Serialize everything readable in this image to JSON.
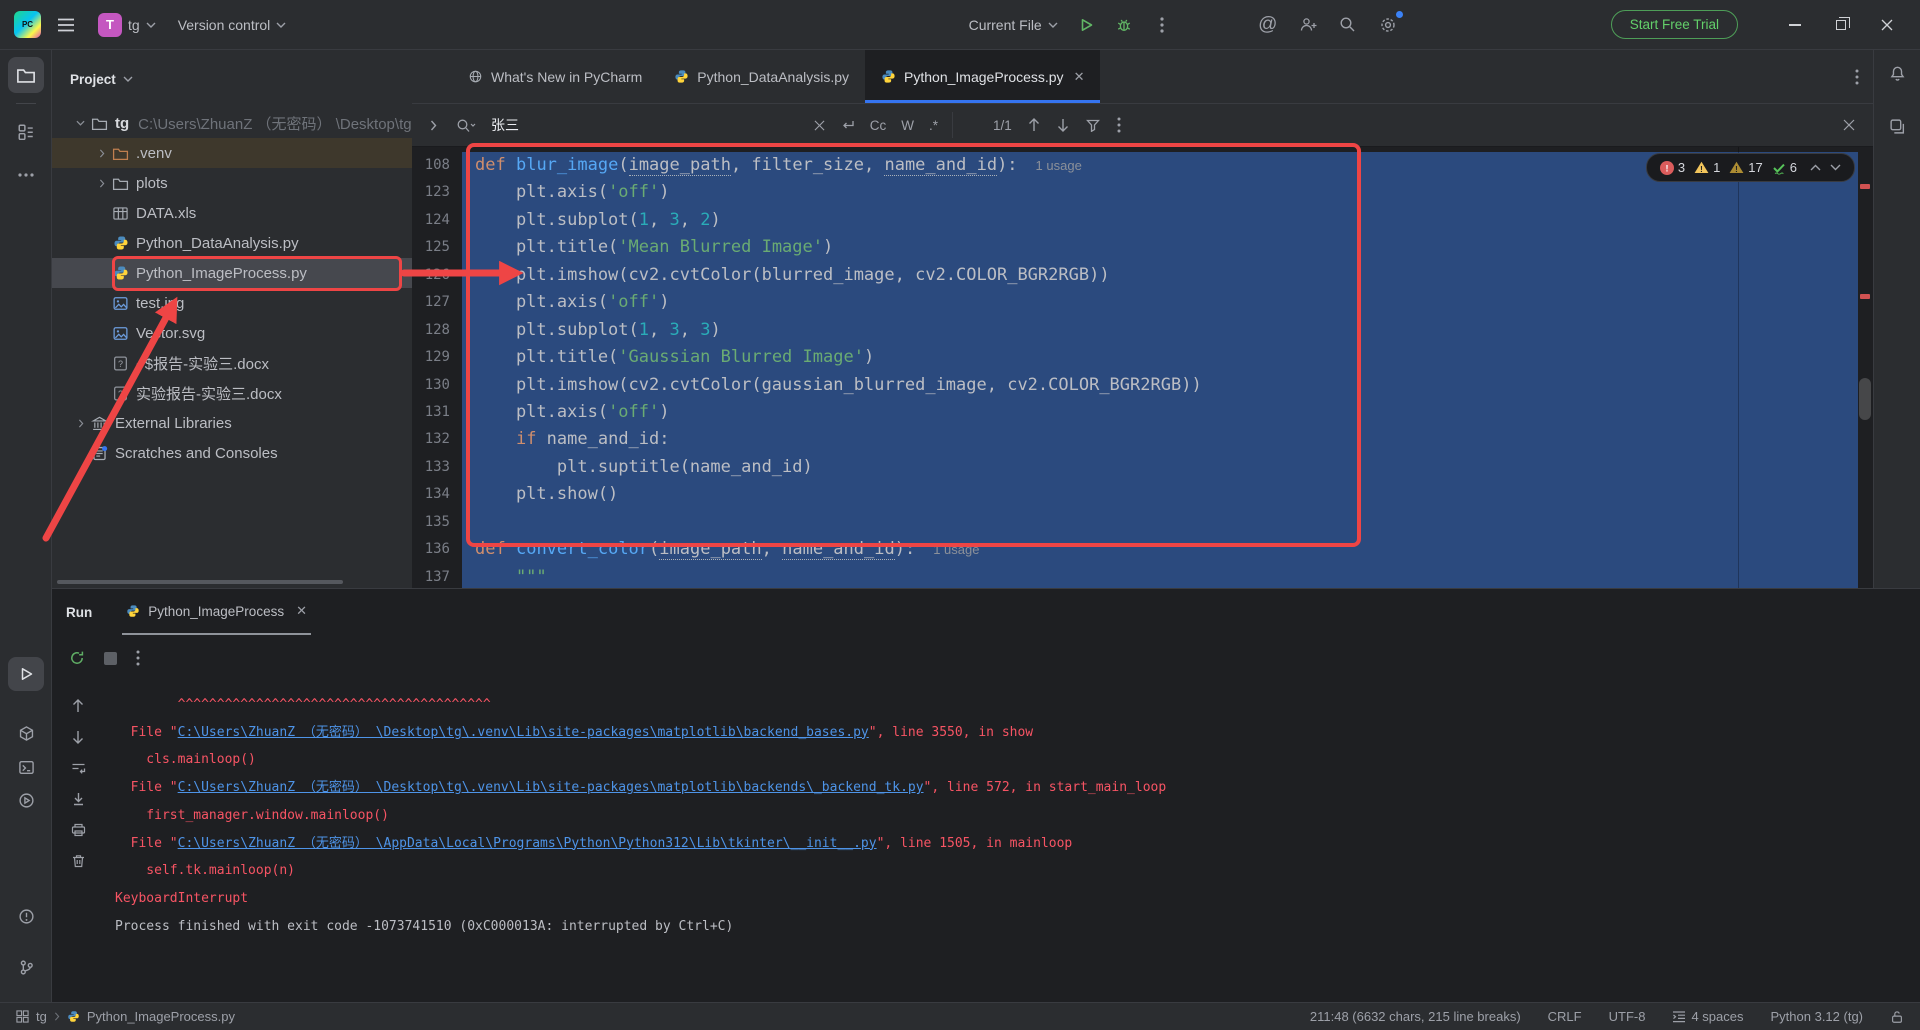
{
  "titlebar": {
    "project": "tg",
    "avatar": "T",
    "version_control": "Version control",
    "run_config": "Current File",
    "trial": "Start Free Trial"
  },
  "tabs": [
    {
      "label": "What's New in PyCharm"
    },
    {
      "label": "Python_DataAnalysis.py"
    },
    {
      "label": "Python_ImageProcess.py"
    }
  ],
  "search": {
    "query": "张三",
    "results": "1/1",
    "match_case": "Cc",
    "words": "W",
    "regex": ".*"
  },
  "inspections": {
    "errors": "3",
    "warnings": "1",
    "weak_warnings": "17",
    "passed": "6"
  },
  "project": {
    "header": "Project",
    "tree": [
      {
        "lvl": 0,
        "chev": "v",
        "icon": "folder",
        "name": "tg",
        "bold": true,
        "path": "C:\\Users\\ZhuanZ （无密码） \\Desktop\\tg"
      },
      {
        "lvl": 1,
        "chev": ">",
        "icon": "folder_venv",
        "name": ".venv",
        "cls": "venv"
      },
      {
        "lvl": 1,
        "chev": ">",
        "icon": "folder",
        "name": "plots"
      },
      {
        "lvl": 1,
        "icon": "table",
        "name": "DATA.xls"
      },
      {
        "lvl": 1,
        "icon": "python",
        "name": "Python_DataAnalysis.py"
      },
      {
        "lvl": 1,
        "icon": "python",
        "name": "Python_ImageProcess.py",
        "cls": "sel"
      },
      {
        "lvl": 1,
        "icon": "image",
        "name": "test.jpg"
      },
      {
        "lvl": 1,
        "icon": "image",
        "name": "Vector.svg"
      },
      {
        "lvl": 1,
        "icon": "docq",
        "name": "~$报告-实验三.docx"
      },
      {
        "lvl": 1,
        "icon": "docq",
        "name": "实验报告-实验三.docx"
      },
      {
        "lvl": 0,
        "chev": ">",
        "icon": "lib",
        "name": "External Libraries"
      },
      {
        "lvl": 0,
        "icon": "scratch",
        "name": "Scratches and Consoles"
      }
    ]
  },
  "editor": {
    "lines": [
      {
        "n": "108",
        "t": [
          [
            "k",
            "def"
          ],
          [
            "p",
            " "
          ],
          [
            "f",
            "blur_image"
          ],
          [
            "p",
            "("
          ],
          [
            "u",
            "image_path"
          ],
          [
            "p",
            ", filter_size, "
          ],
          [
            "u",
            "name_and_id"
          ],
          [
            "p",
            "):"
          ],
          [
            "h",
            "1 usage"
          ]
        ]
      },
      {
        "n": "123",
        "t": [
          [
            "p",
            "    plt.axis("
          ],
          [
            "s",
            "'off'"
          ],
          [
            "p",
            ")"
          ]
        ]
      },
      {
        "n": "124",
        "t": [
          [
            "p",
            "    plt.subplot("
          ],
          [
            "n2",
            "1"
          ],
          [
            "p",
            ", "
          ],
          [
            "n2",
            "3"
          ],
          [
            "p",
            ", "
          ],
          [
            "n2",
            "2"
          ],
          [
            "p",
            ")"
          ]
        ]
      },
      {
        "n": "125",
        "t": [
          [
            "p",
            "    plt.title("
          ],
          [
            "s",
            "'Mean Blurred Image'"
          ],
          [
            "p",
            ")"
          ]
        ]
      },
      {
        "n": "126",
        "t": [
          [
            "p",
            "    plt.imshow(cv2.cvtColor(blurred_image, cv2.COLOR_BGR2RGB))"
          ]
        ]
      },
      {
        "n": "127",
        "t": [
          [
            "p",
            "    plt.axis("
          ],
          [
            "s",
            "'off'"
          ],
          [
            "p",
            ")"
          ]
        ]
      },
      {
        "n": "128",
        "t": [
          [
            "p",
            "    plt.subplot("
          ],
          [
            "n2",
            "1"
          ],
          [
            "p",
            ", "
          ],
          [
            "n2",
            "3"
          ],
          [
            "p",
            ", "
          ],
          [
            "n2",
            "3"
          ],
          [
            "p",
            ")"
          ]
        ]
      },
      {
        "n": "129",
        "t": [
          [
            "p",
            "    plt.title("
          ],
          [
            "s",
            "'Gaussian Blurred Image'"
          ],
          [
            "p",
            ")"
          ]
        ]
      },
      {
        "n": "130",
        "t": [
          [
            "p",
            "    plt.imshow(cv2.cvtColor(gaussian_blurred_image, cv2.COLOR_BGR2RGB))"
          ]
        ]
      },
      {
        "n": "131",
        "t": [
          [
            "p",
            "    plt.axis("
          ],
          [
            "s",
            "'off'"
          ],
          [
            "p",
            ")"
          ]
        ]
      },
      {
        "n": "132",
        "t": [
          [
            "p",
            "    "
          ],
          [
            "k",
            "if"
          ],
          [
            "p",
            " name_and_id:"
          ]
        ]
      },
      {
        "n": "133",
        "t": [
          [
            "p",
            "        plt.suptitle(name_and_id)"
          ]
        ]
      },
      {
        "n": "134",
        "t": [
          [
            "p",
            "    plt.show()"
          ]
        ]
      },
      {
        "n": "135",
        "t": [
          [
            "p",
            ""
          ]
        ]
      },
      {
        "n": "136",
        "t": [
          [
            "k",
            "def"
          ],
          [
            "p",
            " "
          ],
          [
            "f",
            "convert_color"
          ],
          [
            "p",
            "("
          ],
          [
            "u",
            "image_path"
          ],
          [
            "p",
            ", "
          ],
          [
            "u",
            "name_and_id"
          ],
          [
            "p",
            "):"
          ],
          [
            "h",
            "1 usage"
          ]
        ]
      },
      {
        "n": "137",
        "t": [
          [
            "s",
            "    \"\"\""
          ]
        ]
      }
    ]
  },
  "run": {
    "label": "Run",
    "tab": "Python_ImageProcess",
    "console": [
      {
        "parts": [
          [
            "r",
            "        ^^^^^^^^^^^^^^^^^^^^^^^^^^^^^^^^^^^^^^^^"
          ]
        ]
      },
      {
        "parts": [
          [
            "r",
            "  File \""
          ],
          [
            "l",
            "C:\\Users\\ZhuanZ （无密码） \\Desktop\\tg\\.venv\\Lib\\site-packages\\matplotlib\\backend_bases.py"
          ],
          [
            "r",
            "\", line 3550, in show"
          ]
        ]
      },
      {
        "parts": [
          [
            "r",
            "    cls.mainloop()"
          ]
        ]
      },
      {
        "parts": [
          [
            "r",
            "  File \""
          ],
          [
            "l",
            "C:\\Users\\ZhuanZ （无密码） \\Desktop\\tg\\.venv\\Lib\\site-packages\\matplotlib\\backends\\_backend_tk.py"
          ],
          [
            "r",
            "\", line 572, in start_main_loop"
          ]
        ]
      },
      {
        "parts": [
          [
            "r",
            "    first_manager.window.mainloop()"
          ]
        ]
      },
      {
        "parts": [
          [
            "r",
            "  File \""
          ],
          [
            "l",
            "C:\\Users\\ZhuanZ （无密码） \\AppData\\Local\\Programs\\Python\\Python312\\Lib\\tkinter\\__init__.py"
          ],
          [
            "r",
            "\", line 1505, in mainloop"
          ]
        ]
      },
      {
        "parts": [
          [
            "r",
            "    self.tk.mainloop(n)"
          ]
        ]
      },
      {
        "parts": [
          [
            "r",
            "KeyboardInterrupt"
          ]
        ]
      },
      {
        "parts": [
          [
            "p",
            ""
          ]
        ]
      },
      {
        "parts": [
          [
            "p",
            "Process finished with exit code -1073741510 (0xC000013A: interrupted by Ctrl+C)"
          ]
        ]
      }
    ]
  },
  "status": {
    "project": "tg",
    "file": "Python_ImageProcess.py",
    "caret": "211:48 (6632 chars, 215 line breaks)",
    "line_separator": "CRLF",
    "encoding": "UTF-8",
    "indent": "4 spaces",
    "interpreter": "Python 3.12 (tg)"
  },
  "icons": {
    "ai_glyph": "@",
    "logo_glyph": "PC"
  }
}
